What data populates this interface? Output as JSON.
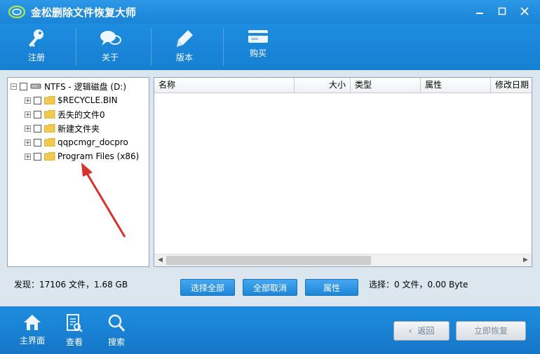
{
  "window": {
    "title": "金松删除文件恢复大师"
  },
  "toolbar": {
    "items": [
      {
        "label": "注册",
        "icon": "key-icon"
      },
      {
        "label": "关于",
        "icon": "chat-icon"
      },
      {
        "label": "版本",
        "icon": "pen-icon"
      },
      {
        "label": "购买",
        "icon": "card-icon"
      }
    ]
  },
  "tree": {
    "root": "NTFS - 逻辑磁盘 (D:)",
    "items": [
      "$RECYCLE.BIN",
      "丢失的文件0",
      "新建文件夹",
      "qqpcmgr_docpro",
      "Program Files (x86)"
    ]
  },
  "list": {
    "columns": [
      "名称",
      "大小",
      "类型",
      "属性",
      "修改日期"
    ]
  },
  "status": {
    "found": "发现：17106 文件，1.68 GB",
    "selected": "选择：0 文件，0.00 Byte"
  },
  "actions": {
    "select_all": "选择全部",
    "deselect_all": "全部取消",
    "properties": "属性"
  },
  "bottom": {
    "items": [
      {
        "label": "主界面",
        "icon": "home-icon"
      },
      {
        "label": "查看",
        "icon": "document-search-icon"
      },
      {
        "label": "搜索",
        "icon": "search-icon"
      }
    ],
    "back": "返回",
    "recover": "立即恢复"
  },
  "colors": {
    "primary": "#1b84d6",
    "panel": "#dbe6ef",
    "folder": "#f2c94c"
  }
}
